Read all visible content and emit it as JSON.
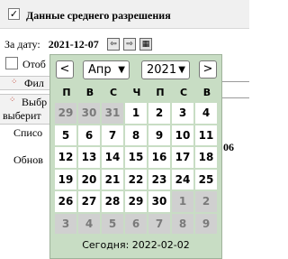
{
  "header": {
    "checked": "✓",
    "title": "Данные среднего разрешения"
  },
  "date": {
    "label": "За дату:",
    "value": "2021-12-07"
  },
  "buttons": {
    "prev": "⇦",
    "next": "⇨",
    "calendar": "▦"
  },
  "left": {
    "item1": "Отоб",
    "item2": "Фил",
    "item3_line1": "Выбр",
    "item3_line2": "выберит",
    "item4": "Списо",
    "item5": "Обнов",
    "right_fragment": "06"
  },
  "calendar": {
    "prev": "<",
    "next": ">",
    "month": "Апр",
    "year": "2021",
    "weekdays": [
      "П",
      "В",
      "С",
      "Ч",
      "П",
      "С",
      "В"
    ],
    "weeks": [
      [
        {
          "d": "29",
          "o": true
        },
        {
          "d": "30",
          "o": true
        },
        {
          "d": "31",
          "o": true
        },
        {
          "d": "1",
          "o": false
        },
        {
          "d": "2",
          "o": false
        },
        {
          "d": "3",
          "o": false
        },
        {
          "d": "4",
          "o": false
        }
      ],
      [
        {
          "d": "5",
          "o": false
        },
        {
          "d": "6",
          "o": false
        },
        {
          "d": "7",
          "o": false
        },
        {
          "d": "8",
          "o": false
        },
        {
          "d": "9",
          "o": false
        },
        {
          "d": "10",
          "o": false
        },
        {
          "d": "11",
          "o": false
        }
      ],
      [
        {
          "d": "12",
          "o": false
        },
        {
          "d": "13",
          "o": false
        },
        {
          "d": "14",
          "o": false
        },
        {
          "d": "15",
          "o": false
        },
        {
          "d": "16",
          "o": false
        },
        {
          "d": "17",
          "o": false
        },
        {
          "d": "18",
          "o": false
        }
      ],
      [
        {
          "d": "19",
          "o": false
        },
        {
          "d": "20",
          "o": false
        },
        {
          "d": "21",
          "o": false
        },
        {
          "d": "22",
          "o": false
        },
        {
          "d": "23",
          "o": false
        },
        {
          "d": "24",
          "o": false
        },
        {
          "d": "25",
          "o": false
        }
      ],
      [
        {
          "d": "26",
          "o": false
        },
        {
          "d": "27",
          "o": false
        },
        {
          "d": "28",
          "o": false
        },
        {
          "d": "29",
          "o": false
        },
        {
          "d": "30",
          "o": false
        },
        {
          "d": "1",
          "o": true
        },
        {
          "d": "2",
          "o": true
        }
      ],
      [
        {
          "d": "3",
          "o": true
        },
        {
          "d": "4",
          "o": true
        },
        {
          "d": "5",
          "o": true
        },
        {
          "d": "6",
          "o": true
        },
        {
          "d": "7",
          "o": true
        },
        {
          "d": "8",
          "o": true
        },
        {
          "d": "9",
          "o": true
        }
      ]
    ],
    "today": "Сегодня: 2022-02-02"
  }
}
